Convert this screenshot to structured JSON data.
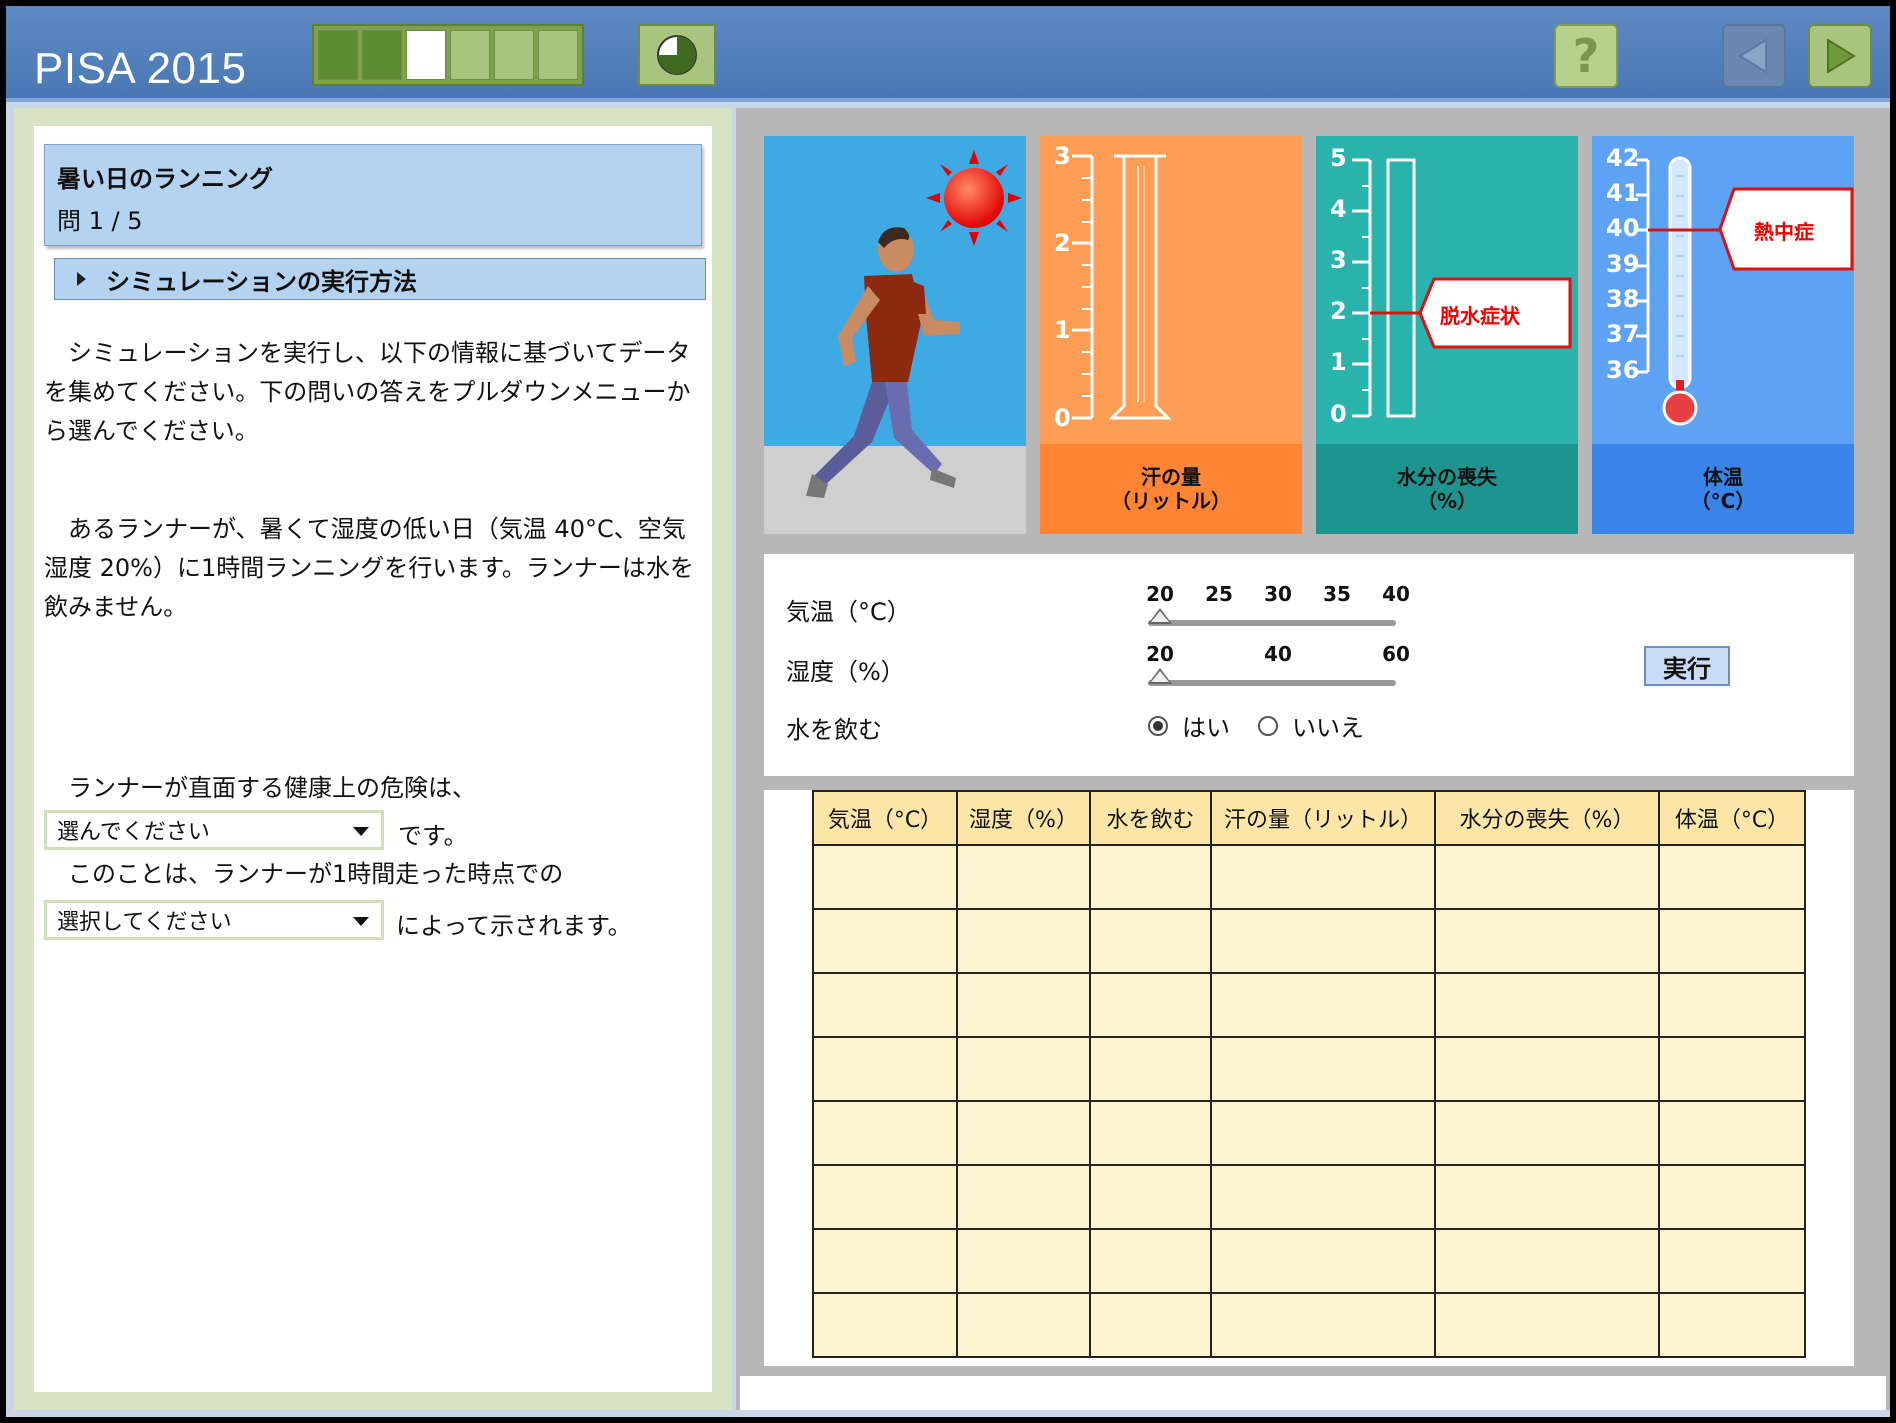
{
  "header": {
    "logo": "PISA 2015",
    "progress": [
      "done",
      "done",
      "current",
      "todo",
      "todo",
      "todo"
    ],
    "help_label": "?"
  },
  "left": {
    "title": "暑い日のランニング",
    "question_number": "問 1 / 5",
    "howto_label": "シミュレーションの実行方法",
    "para1": "　シミュレーションを実行し、以下の情報に基づいてデータを集めてください。下の問いの答えをプルダウンメニューから選んでください。",
    "para2": "　あるランナーが、暑くて湿度の低い日（気温 40°C、空気湿度 20%）に1時間ランニングを行います。ランナーは水を飲みません。",
    "q_line1": "　ランナーが直面する健康上の危険は、",
    "dropdown1": "選んでください",
    "after_dd1": "です。",
    "q_line2": "　このことは、ランナーが1時間走った時点での",
    "dropdown2": "選択してください",
    "after_dd2": "によって示されます。"
  },
  "gauges": {
    "sweat": {
      "label1": "汗の量",
      "label2": "（リットル）",
      "ticks": [
        "3",
        "2",
        "1",
        "0"
      ]
    },
    "water": {
      "label1": "水分の喪失",
      "label2": "（%）",
      "ticks": [
        "5",
        "4",
        "3",
        "2",
        "1",
        "0"
      ],
      "callout": "脱水症状",
      "callout_value": 2
    },
    "temp": {
      "label1": "体温",
      "label2": "（°C）",
      "ticks": [
        "42",
        "41",
        "40",
        "39",
        "38",
        "37",
        "36"
      ],
      "callout": "熱中症",
      "callout_value": 40
    }
  },
  "controls": {
    "temp_label": "気温（°C）",
    "temp_ticks": [
      "20",
      "25",
      "30",
      "35",
      "40"
    ],
    "temp_value": 20,
    "humidity_label": "湿度（%）",
    "humidity_ticks": [
      "20",
      "40",
      "60"
    ],
    "humidity_value": 20,
    "drink_label": "水を飲む",
    "opt_yes": "はい",
    "opt_no": "いいえ",
    "selected": "yes",
    "run_label": "実行"
  },
  "table": {
    "headers": [
      "気温（°C）",
      "湿度（%）",
      "水を飲む",
      "汗の量（リットル）",
      "水分の喪失（%）",
      "体温（°C）"
    ],
    "rows": 8
  },
  "colors": {
    "sweat": "#ff9d55",
    "water": "#2ab3ac",
    "temp": "#5ea2f3",
    "table_header": "#fbe6a8",
    "table_cell": "#fdf5cf"
  }
}
